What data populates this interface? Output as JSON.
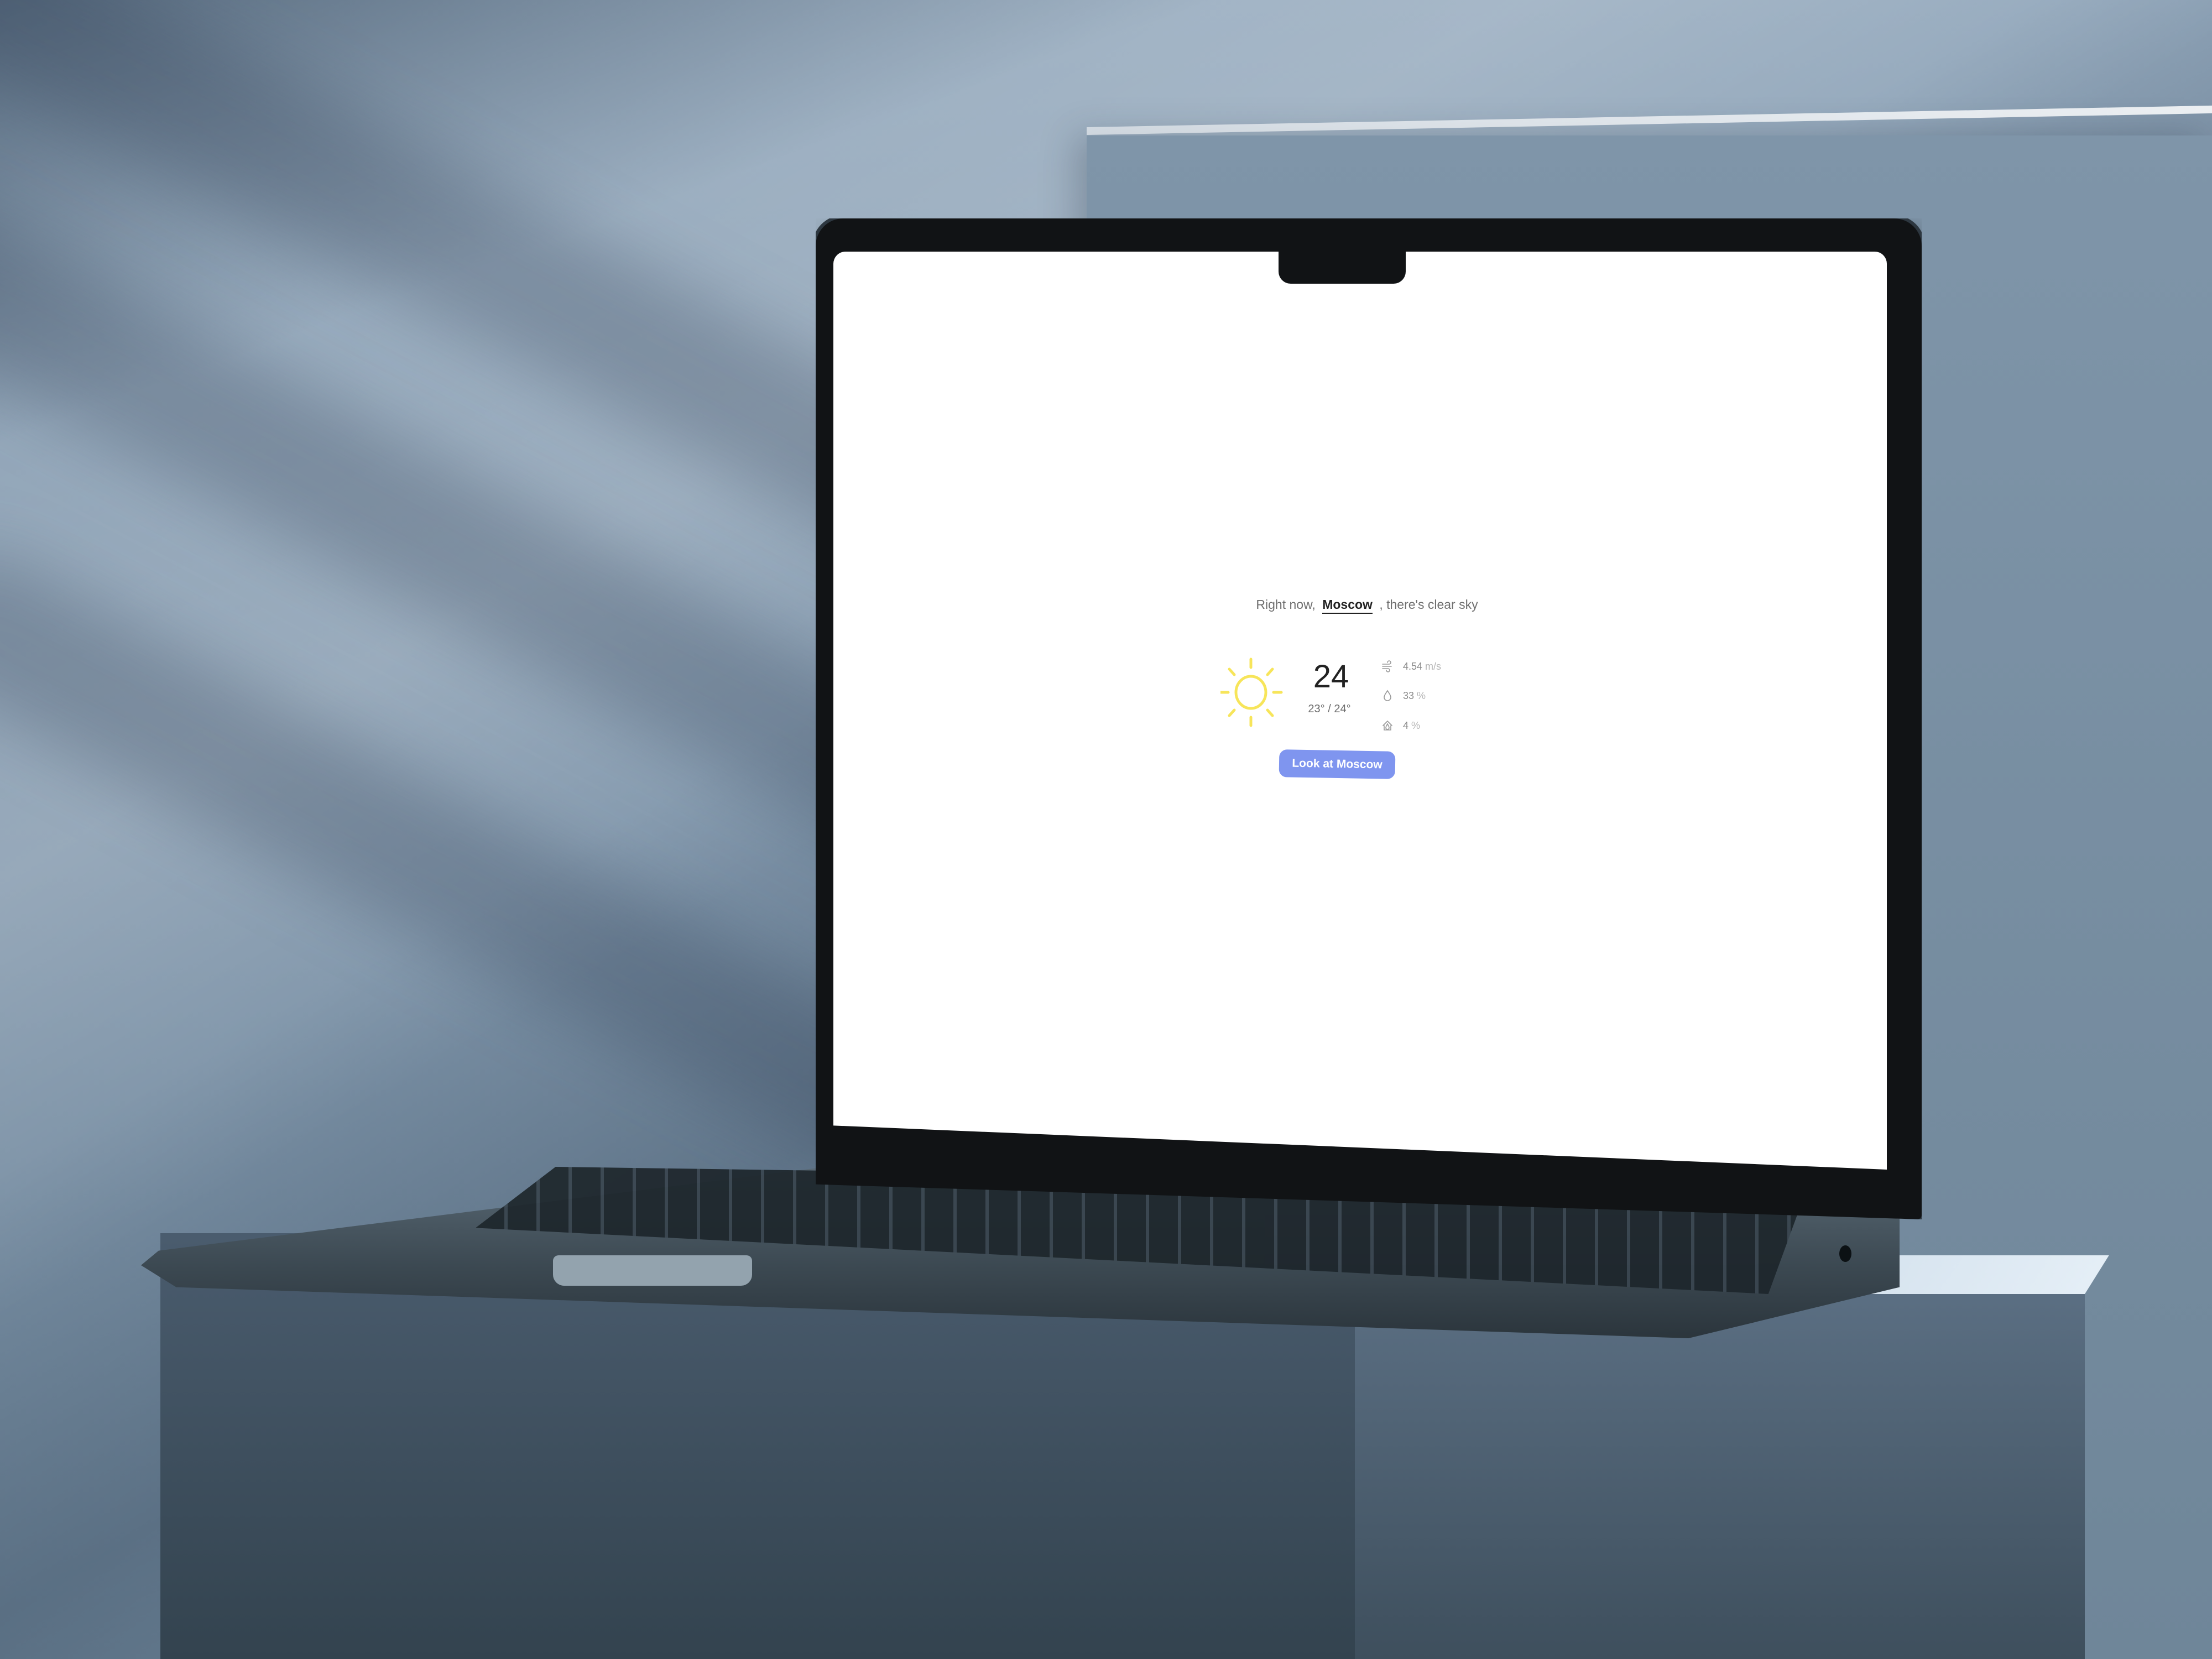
{
  "weather": {
    "intro": "Right now,",
    "city": "Moscow",
    "condition_text": ", there's clear sky",
    "temperature": "24",
    "range": "23° / 24°",
    "metrics": [
      {
        "icon": "wind-icon",
        "value": "4.54",
        "unit": "m/s"
      },
      {
        "icon": "humidity-drop-icon",
        "value": "33",
        "unit": "%"
      },
      {
        "icon": "precipitation-icon",
        "value": "4",
        "unit": "%"
      }
    ],
    "button_label": "Look at Moscow",
    "icon": "sun-icon"
  },
  "colors": {
    "accent": "#7f95ef",
    "sun": "#f7e55a",
    "text_primary": "#222222",
    "text_secondary": "#6f6f6f",
    "screen_background": "#ffffff"
  }
}
